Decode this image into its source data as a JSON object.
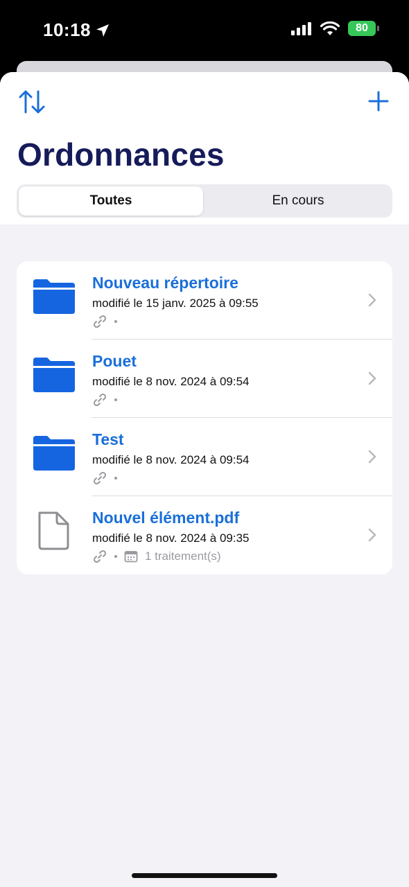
{
  "status_bar": {
    "time": "10:18",
    "battery_level": "80"
  },
  "header": {
    "title": "Ordonnances",
    "sort_icon": "sort-arrows-icon",
    "add_icon": "plus-icon"
  },
  "segments": {
    "all_label": "Toutes",
    "ongoing_label": "En cours",
    "selected": "Toutes"
  },
  "items": [
    {
      "title": "Nouveau répertoire",
      "modified": "modifié le 15 janv. 2025 à 09:55",
      "type": "folder",
      "treatments": ""
    },
    {
      "title": "Pouet",
      "modified": "modifié le 8 nov. 2024 à 09:54",
      "type": "folder",
      "treatments": ""
    },
    {
      "title": "Test",
      "modified": "modifié le 8 nov. 2024 à 09:54",
      "type": "folder",
      "treatments": ""
    },
    {
      "title": "Nouvel élément.pdf",
      "modified": "modifié le 8 nov. 2024 à 09:35",
      "type": "file",
      "treatments": "1 traitement(s)"
    }
  ],
  "colors": {
    "accent": "#1a6fd8",
    "title": "#161b5a",
    "folder": "#1565e0",
    "battery": "#35c759"
  }
}
